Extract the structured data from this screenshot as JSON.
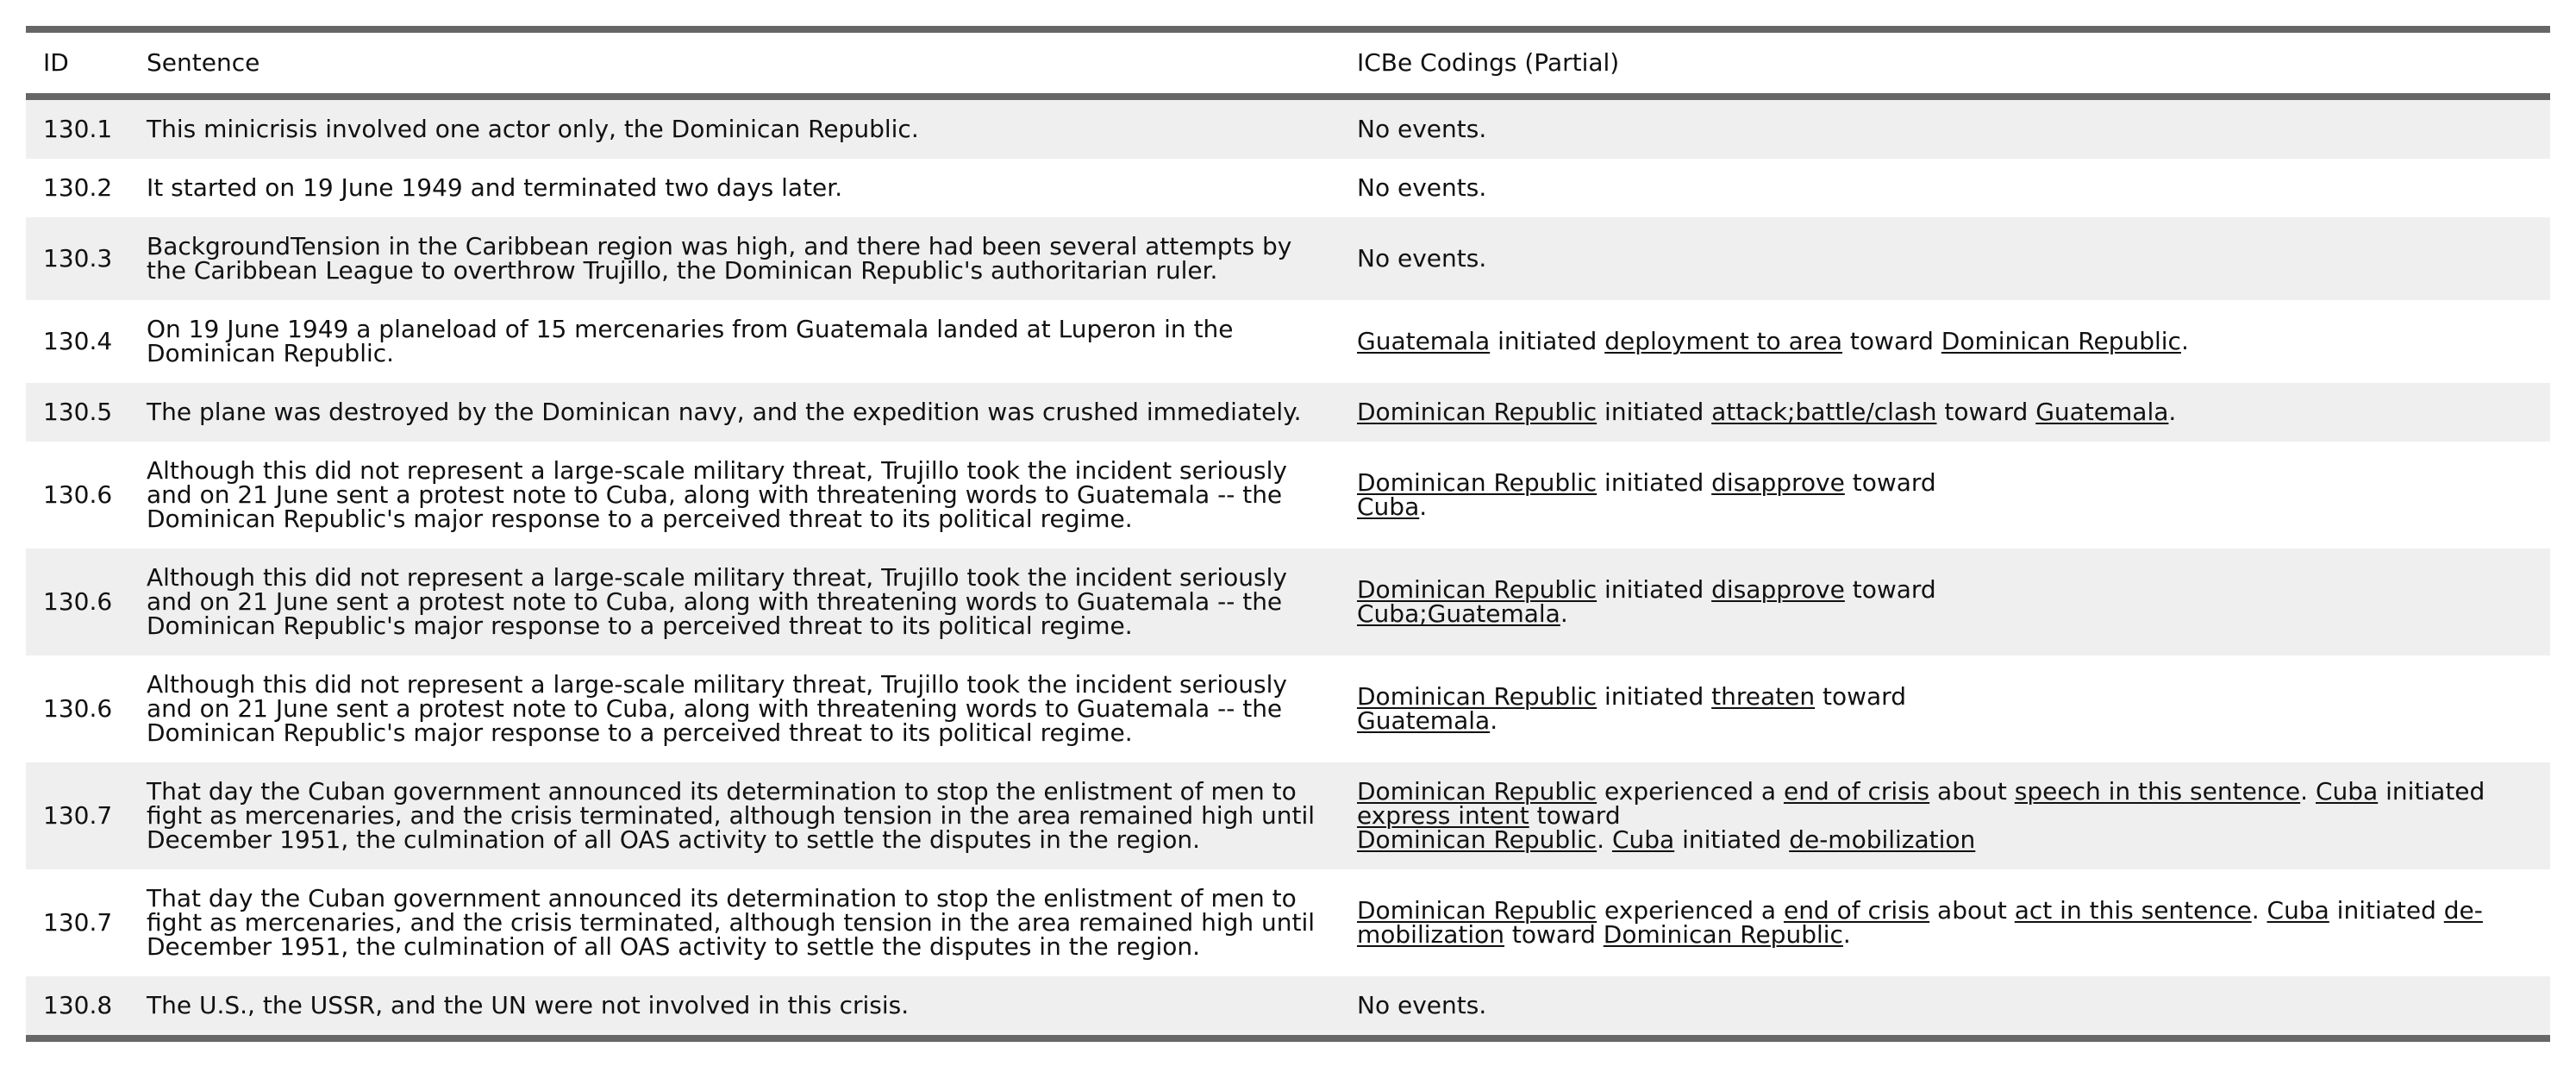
{
  "headers": {
    "id": "ID",
    "sentence": "Sentence",
    "codings": "ICBe Codings (Partial)"
  },
  "rows": [
    {
      "id": "130.1",
      "sentence": [
        "This minicrisis involved one actor only, the Dominican Republic."
      ],
      "coding": [
        [
          "No events."
        ]
      ]
    },
    {
      "id": "130.2",
      "sentence": [
        "It started on 19 June 1949 and terminated two days later."
      ],
      "coding": [
        [
          "No events."
        ]
      ]
    },
    {
      "id": "130.3",
      "sentence": [
        "BackgroundTension in the Caribbean region was high, and there had been several attempts by",
        "the Caribbean League to overthrow Trujillo, the Dominican Republic's authoritarian ruler."
      ],
      "coding": [
        [
          "No events."
        ]
      ]
    },
    {
      "id": "130.4",
      "sentence": [
        "On 19 June 1949 a planeload of 15 mercenaries from Guatemala landed at Luperon in the",
        "Dominican Republic."
      ],
      "coding": [
        [
          "Guatemala",
          " initiated ",
          "deployment to area",
          " toward ",
          "Dominican Republic",
          "."
        ]
      ]
    },
    {
      "id": "130.5",
      "sentence": [
        "The plane was destroyed by the Dominican navy, and the expedition was crushed immediately."
      ],
      "coding": [
        [
          "Dominican Republic",
          " initiated ",
          "attack;battle/clash",
          " toward ",
          "Guatemala",
          "."
        ]
      ]
    },
    {
      "id": "130.6",
      "sentence": [
        "Although this did not represent a large-scale military threat, Trujillo took the incident seriously",
        "and on 21 June sent a protest note to Cuba, along with threatening words to Guatemala -- the",
        "Dominican Republic's major response to a perceived threat to its political regime."
      ],
      "coding": [
        [
          "Dominican Republic",
          " initiated ",
          "disapprove",
          " toward"
        ],
        [
          "Cuba",
          "."
        ]
      ]
    },
    {
      "id": "130.6",
      "sentence": [
        "Although this did not represent a large-scale military threat, Trujillo took the incident seriously",
        "and on 21 June sent a protest note to Cuba, along with threatening words to Guatemala -- the",
        "Dominican Republic's major response to a perceived threat to its political regime."
      ],
      "coding": [
        [
          "Dominican Republic",
          " initiated ",
          "disapprove",
          " toward"
        ],
        [
          "Cuba;Guatemala",
          "."
        ]
      ]
    },
    {
      "id": "130.6",
      "sentence": [
        "Although this did not represent a large-scale military threat, Trujillo took the incident seriously",
        "and on 21 June sent a protest note to Cuba, along with threatening words to Guatemala -- the",
        "Dominican Republic's major response to a perceived threat to its political regime."
      ],
      "coding": [
        [
          "Dominican Republic",
          " initiated ",
          "threaten",
          " toward"
        ],
        [
          "Guatemala",
          "."
        ]
      ]
    },
    {
      "id": "130.7",
      "sentence": [
        "That day the Cuban government announced its determination to stop the enlistment of men to",
        "fight as mercenaries, and the crisis terminated, although tension in the area remained high until",
        "December 1951, the culmination of all OAS activity to settle the disputes in the region."
      ],
      "coding": [
        [
          "Dominican Republic",
          " experienced a ",
          "end of crisis",
          " about ",
          "speech in this sentence",
          ". ",
          "Cuba",
          " initiated"
        ],
        [
          "express intent",
          " toward"
        ],
        [
          "Dominican Republic",
          ". ",
          "Cuba",
          " initiated ",
          "de-mobilization"
        ]
      ]
    },
    {
      "id": "130.7",
      "sentence": [
        "That day the Cuban government announced its determination to stop the enlistment of men to",
        "fight as mercenaries, and the crisis terminated, although tension in the area remained high until",
        "December 1951, the culmination of all OAS activity to settle the disputes in the region."
      ],
      "coding": [
        [
          "Dominican Republic",
          " experienced a ",
          "end of crisis",
          " about ",
          "act in this sentence",
          ". ",
          "Cuba",
          " initiated ",
          "de-"
        ],
        [
          "mobilization",
          " toward ",
          "Dominican Republic",
          "."
        ]
      ]
    },
    {
      "id": "130.8",
      "sentence": [
        "The U.S., the USSR, and the UN were not involved in this crisis."
      ],
      "coding": [
        [
          "No events."
        ]
      ]
    }
  ]
}
